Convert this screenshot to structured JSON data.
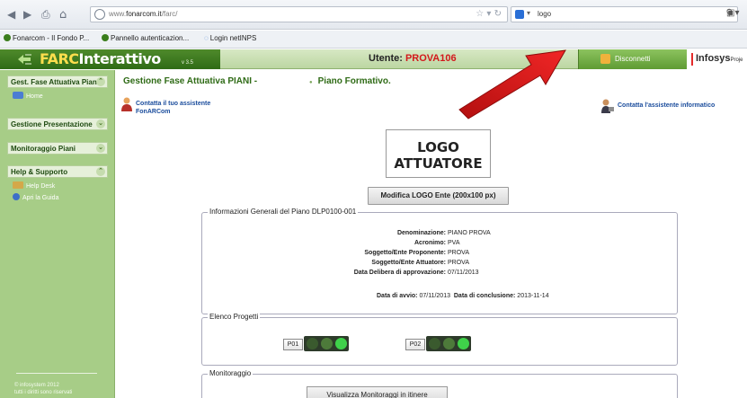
{
  "browser": {
    "url_host": "www.",
    "url_domain": "fonarcom.it",
    "url_path": "/farc/",
    "search_value": "logo",
    "bookmarks": [
      "Fonarcom - Il Fondo P...",
      "Pannello autenticazion...",
      "Login netINPS"
    ]
  },
  "header": {
    "logo_prefix": "FARC",
    "logo_suffix": "Interattivo",
    "version": "v 3.5",
    "user_label": "Utente:",
    "user_name": "PROVA106",
    "disconnect_label": "Disconnetti",
    "infosys_label": "Infosys",
    "infosys_small": "Proje"
  },
  "sidebar": {
    "sections": [
      {
        "title": "Gest. Fase Attuativa Piani"
      },
      {
        "title": "Gestione Presentazione"
      },
      {
        "title": "Monitoraggio Piani"
      },
      {
        "title": "Help & Supporto"
      }
    ],
    "items": {
      "home": "Home",
      "help_desk": "Help Desk",
      "guide": "Apri la Guida"
    },
    "footer_line1": "© infosystem 2012",
    "footer_line2": "tutti i diritti sono riservati"
  },
  "main": {
    "title_left": "Gestione Fase Attuativa PIANI -",
    "title_right": "Piano Formativo.",
    "assist_left_line1": "Contatta il tuo assistente",
    "assist_left_line2": "FonARCom",
    "assist_right": "Contatta l'assistente informatico",
    "logo_line1": "LOGO",
    "logo_line2": "ATTUATORE",
    "logo_button": "Modifica LOGO Ente (200x100 px)",
    "info_legend": "Informazioni Generali del Piano DLP0100-001",
    "info_rows": [
      {
        "k": "Denominazione:",
        "v": "PIANO PROVA"
      },
      {
        "k": "Acronimo:",
        "v": "PVA"
      },
      {
        "k": "Soggetto/Ente Proponente:",
        "v": "PROVA"
      },
      {
        "k": "Soggetto/Ente Attuatore:",
        "v": "PROVA"
      },
      {
        "k": "Data Delibera di approvazione:",
        "v": "07/11/2013"
      }
    ],
    "start_label": "Data di avvio:",
    "start_value": "07/11/2013",
    "end_label": "Data di conclusione:",
    "end_value": "2013-11-14",
    "projects_legend": "Elenco Progetti",
    "projects": [
      "P01",
      "P02"
    ],
    "monitoring_legend": "Monitoraggio",
    "monitoring_button": "Visualizza Monitoraggi in itinere"
  },
  "colors": {
    "brand_green": "#2f6b16",
    "user_red": "#d3181b",
    "link_blue": "#1a4c9c",
    "arrow_red": "#e01818"
  }
}
